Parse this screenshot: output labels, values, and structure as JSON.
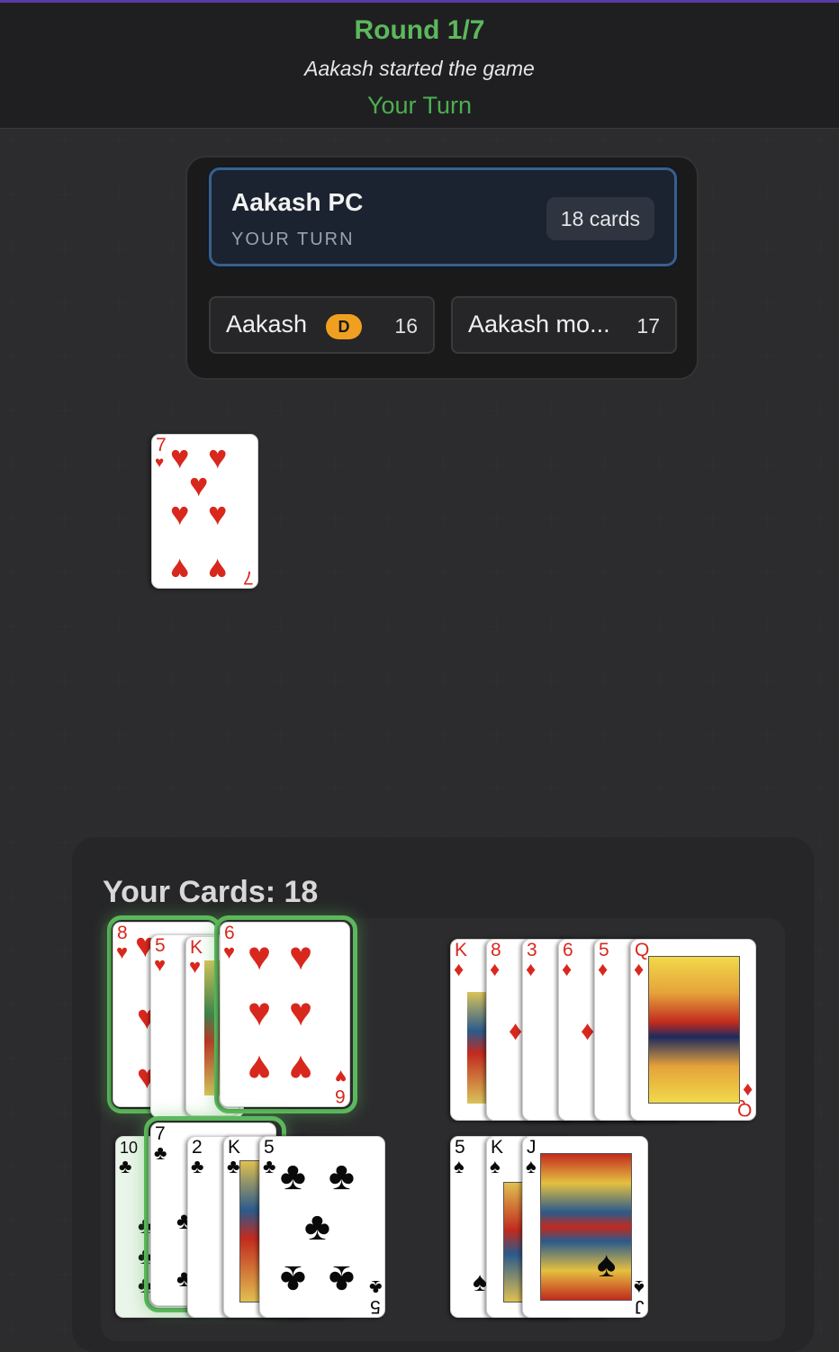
{
  "header": {
    "round": "Round 1/7",
    "started": "Aakash started the game",
    "turn": "Your Turn"
  },
  "players": {
    "active": {
      "name": "Aakash PC",
      "status": "YOUR TURN",
      "cards": "18 cards"
    },
    "opponents": [
      {
        "name": "Aakash",
        "badge": "D",
        "count": "16"
      },
      {
        "name": "Aakash mo...",
        "count": "17"
      }
    ]
  },
  "discard": {
    "rank": "7",
    "suit": "♥"
  },
  "hand": {
    "title": "Your Cards: 18",
    "hearts": [
      "8",
      "5",
      "K",
      "6"
    ],
    "diamonds": [
      "K",
      "8",
      "3",
      "6",
      "5",
      "Q"
    ],
    "clubs": [
      "10",
      "7",
      "2",
      "K",
      "5"
    ],
    "spades": [
      "5",
      "K",
      "J"
    ],
    "selected": [
      "8♥",
      "6♥",
      "7♣"
    ]
  },
  "colors": {
    "accent_green": "#5cb85c",
    "active_border": "#3a5f8c",
    "dealer_badge": "#f0a020",
    "red_suit": "#d8281e"
  }
}
